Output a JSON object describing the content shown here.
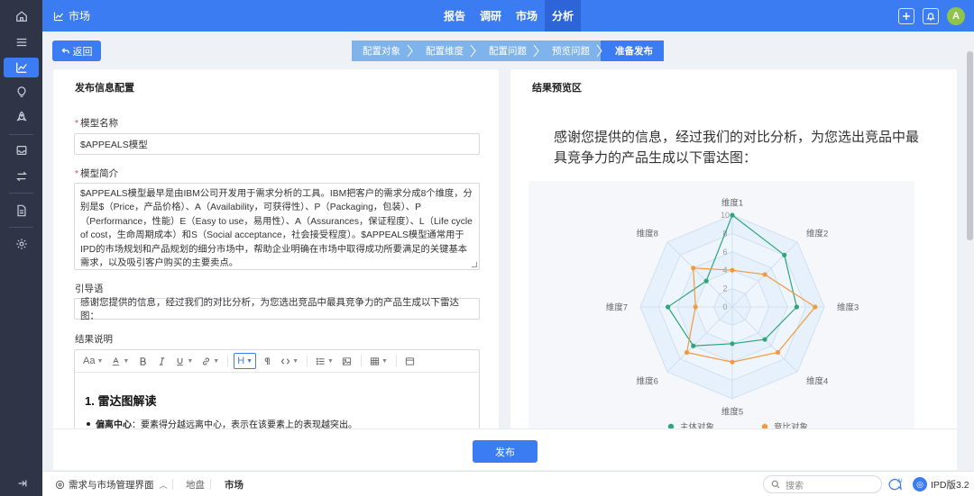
{
  "header": {
    "breadcrumb": "市场",
    "nav": [
      {
        "label": "报告",
        "active": false
      },
      {
        "label": "调研",
        "active": false
      },
      {
        "label": "市场",
        "active": false
      },
      {
        "label": "分析",
        "active": true
      }
    ],
    "avatar_initial": "A"
  },
  "back_label": "返回",
  "steps": [
    {
      "label": "配置对象",
      "active": false
    },
    {
      "label": "配置维度",
      "active": false
    },
    {
      "label": "配置问题",
      "active": false
    },
    {
      "label": "预览问题",
      "active": false
    },
    {
      "label": "准备发布",
      "active": true
    }
  ],
  "left_panel": {
    "title": "发布信息配置",
    "model_name_label": "模型名称",
    "model_name_value": "$APPEALS模型",
    "model_intro_label": "模型简介",
    "model_intro_value": "$APPEALS模型最早是由IBM公司开发用于需求分析的工具。IBM把客户的需求分成8个维度，分别是$（Price，产品价格）、A（Availability，可获得性）、P（Packaging，包装）、P（Performance，性能）E（Easy to use，易用性）、A（Assurances，保证程度）、L（Life cycle of cost，生命周期成本）和S（Social acceptance，社会接受程度）。$APPEALS模型通常用于IPD的市场规划和产品规划的细分市场中，帮助企业明确在市场中取得成功所要满足的关键基本需求，以及吸引客户购买的主要卖点。",
    "guide_label": "引导语",
    "guide_value": "感谢您提供的信息，经过我们的对比分析，为您选出竞品中最具竞争力的产品生成以下雷达图：",
    "result_label": "结果说明",
    "toolbar": {
      "font_size": "Aa",
      "heading": "H"
    },
    "editor_heading": "1. 雷达图解读",
    "editor_bullet_bold": "偏离中心",
    "editor_bullet_rest": "：要素得分越远离中心，表示在该要素上的表现越突出。"
  },
  "right_panel": {
    "title": "结果预览区",
    "intro": "感谢您提供的信息，经过我们的对比分析，为您选出竞品中最具竞争力的产品生成以下雷达图："
  },
  "chart_data": {
    "type": "radar",
    "categories": [
      "维度1",
      "维度2",
      "维度3",
      "维度4",
      "维度5",
      "维度6",
      "维度7",
      "维度8"
    ],
    "ticks": [
      "0",
      "2",
      "4",
      "6",
      "8",
      "10"
    ],
    "range": [
      0,
      10
    ],
    "series": [
      {
        "name": "主体对象",
        "color": "#2fa57a",
        "values": [
          10,
          8,
          7,
          5,
          4,
          6,
          7,
          4
        ]
      },
      {
        "name": "竞比对象",
        "color": "#f29a3d",
        "values": [
          4,
          5,
          9,
          7,
          6,
          7,
          4,
          6
        ]
      }
    ],
    "legend_position": "bottom"
  },
  "publish_label": "发布",
  "bottombar": {
    "app_switch": "需求与市场管理界面",
    "tabs": [
      "地盘",
      "市场"
    ],
    "search_placeholder": "搜索",
    "ai_label": "AI",
    "version": "IPD版3.2"
  }
}
